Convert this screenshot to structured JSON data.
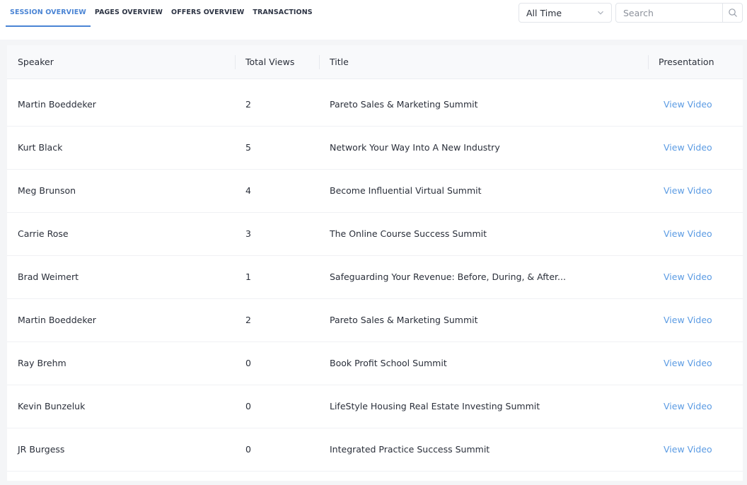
{
  "tabs": [
    {
      "label": "SESSION OVERVIEW",
      "active": true
    },
    {
      "label": "PAGES OVERVIEW",
      "active": false
    },
    {
      "label": "OFFERS OVERVIEW",
      "active": false
    },
    {
      "label": "TRANSACTIONS",
      "active": false
    }
  ],
  "filter": {
    "selected": "All Time",
    "icon": "chevron-down-icon"
  },
  "search": {
    "placeholder": "Search",
    "icon": "search-icon"
  },
  "table": {
    "headers": {
      "speaker": "Speaker",
      "views": "Total Views",
      "title": "Title",
      "presentation": "Presentation"
    },
    "rows": [
      {
        "speaker": "Martin Boeddeker",
        "views": "2",
        "title": "Pareto Sales & Marketing Summit",
        "link": "View Video"
      },
      {
        "speaker": "Kurt Black",
        "views": "5",
        "title": "Network Your Way Into A New Industry",
        "link": "View Video"
      },
      {
        "speaker": "Meg Brunson",
        "views": "4",
        "title": "Become Influential Virtual Summit",
        "link": "View Video"
      },
      {
        "speaker": "Carrie Rose",
        "views": "3",
        "title": "The Online Course Success Summit",
        "link": "View Video"
      },
      {
        "speaker": "Brad Weimert",
        "views": "1",
        "title": "Safeguarding Your Revenue: Before, During, & After...",
        "link": "View Video"
      },
      {
        "speaker": "Martin Boeddeker",
        "views": "2",
        "title": "Pareto Sales & Marketing Summit",
        "link": "View Video"
      },
      {
        "speaker": "Ray Brehm",
        "views": "0",
        "title": "Book Profit School Summit",
        "link": "View Video"
      },
      {
        "speaker": "Kevin Bunzeluk",
        "views": "0",
        "title": "LifeStyle Housing Real Estate Investing Summit",
        "link": "View Video"
      },
      {
        "speaker": "JR Burgess",
        "views": "0",
        "title": "Integrated Practice Success Summit",
        "link": "View Video"
      }
    ]
  },
  "colors": {
    "accent": "#4a84d4",
    "link": "#5b9be3",
    "page_bg": "#f4f5f7",
    "header_bg": "#f8f9fb"
  }
}
